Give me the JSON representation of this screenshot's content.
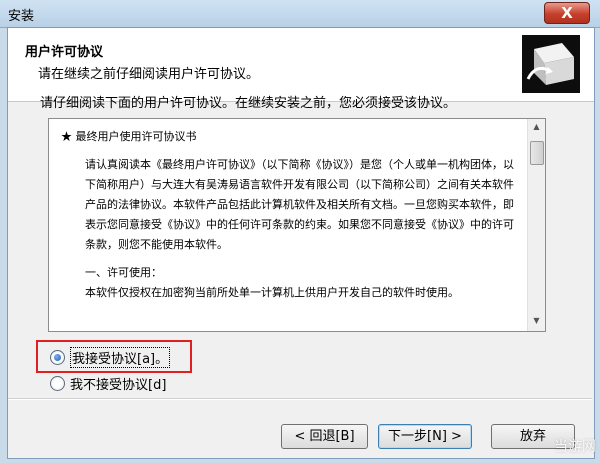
{
  "window": {
    "title": "安装",
    "close_glyph": "X"
  },
  "header": {
    "title": "用户许可协议",
    "subtitle": "请在继续之前仔细阅读用户许可协议。",
    "logo_icon": "install-box-icon"
  },
  "intro": "请仔细阅读下面的用户许可协议。在继续安装之前，您必须接受该协议。",
  "license": {
    "heading": "★ 最终用户使用许可协议书",
    "para1": "请认真阅读本《最终用户许可协议》（以下简称《协议》）是您（个人或单一机构团体，以下简称用户）与大连大有吴涛易语言软件开发有限公司（以下简称公司）之间有关本软件产品的法律协议。本软件产品包括此计算机软件及相关所有文档。一旦您购买本软件，即表示您同意接受《协议》中的任何许可条款的约束。如果您不同意接受《协议》中的许可条款，则您不能使用本软件。",
    "section1": "一、许可使用：",
    "para2": "本软件仅授权在加密狗当前所处单一计算机上供用户开发自己的软件时使用。"
  },
  "options": {
    "accept": "我接受协议[a]。",
    "decline": "我不接受协议[d]",
    "selected": "accept"
  },
  "buttons": {
    "back": "< 回退[B]",
    "next": "下一步[N] >",
    "cancel": "放弃"
  },
  "watermark": "当游网"
}
